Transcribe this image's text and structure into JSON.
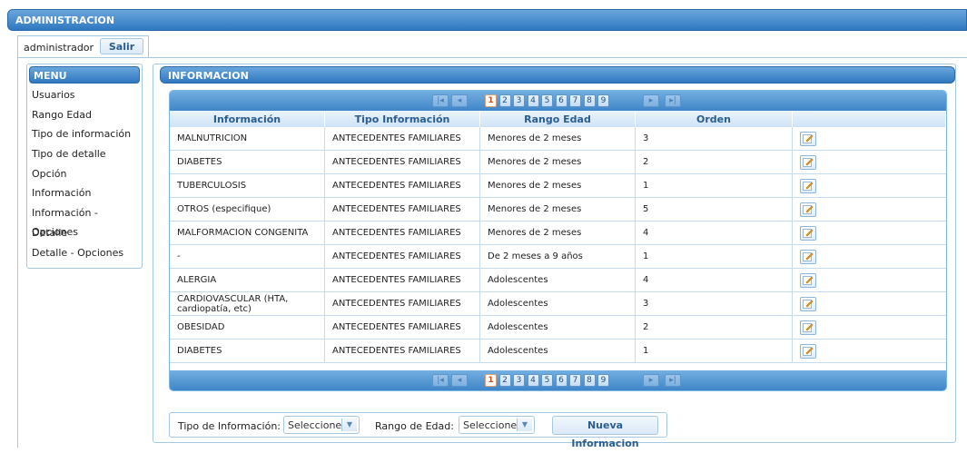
{
  "header": {
    "title": "ADMINISTRACION"
  },
  "user": {
    "name": "administrador",
    "logout_label": "Salir"
  },
  "menu": {
    "title": "MENU",
    "items": [
      {
        "label": "Usuarios"
      },
      {
        "label": "Rango Edad"
      },
      {
        "label": "Tipo de información"
      },
      {
        "label": "Tipo de detalle"
      },
      {
        "label": "Opción"
      },
      {
        "label": "Información"
      },
      {
        "label": "Información - Opciones"
      },
      {
        "label": "Detalle"
      },
      {
        "label": "Detalle - Opciones"
      }
    ]
  },
  "panel": {
    "title": "INFORMACION"
  },
  "pager": {
    "first_icon": "first-page-icon",
    "prev_icon": "prev-page-icon",
    "next_icon": "next-page-icon",
    "last_icon": "last-page-icon",
    "pages": [
      "1",
      "2",
      "3",
      "4",
      "5",
      "6",
      "7",
      "8",
      "9"
    ],
    "current_page": "1"
  },
  "table": {
    "headers": [
      "Información",
      "Tipo Información",
      "Rango Edad",
      "Orden",
      ""
    ],
    "rows": [
      {
        "informacion": "MALNUTRICION",
        "tipo": "ANTECEDENTES FAMILIARES",
        "rango": "Menores de 2 meses",
        "orden": "3"
      },
      {
        "informacion": "DIABETES",
        "tipo": "ANTECEDENTES FAMILIARES",
        "rango": "Menores de 2 meses",
        "orden": "2"
      },
      {
        "informacion": "TUBERCULOSIS",
        "tipo": "ANTECEDENTES FAMILIARES",
        "rango": "Menores de 2 meses",
        "orden": "1"
      },
      {
        "informacion": "OTROS (especifique)",
        "tipo": "ANTECEDENTES FAMILIARES",
        "rango": "Menores de 2 meses",
        "orden": "5"
      },
      {
        "informacion": "MALFORMACION CONGENITA",
        "tipo": "ANTECEDENTES FAMILIARES",
        "rango": "Menores de 2 meses",
        "orden": "4"
      },
      {
        "informacion": "-",
        "tipo": "ANTECEDENTES FAMILIARES",
        "rango": "De 2 meses a 9 años",
        "orden": "1"
      },
      {
        "informacion": "ALERGIA",
        "tipo": "ANTECEDENTES FAMILIARES",
        "rango": "Adolescentes",
        "orden": "4"
      },
      {
        "informacion": "CARDIOVASCULAR (HTA, cardiopatía, etc)",
        "tipo": "ANTECEDENTES FAMILIARES",
        "rango": "Adolescentes",
        "orden": "3"
      },
      {
        "informacion": "OBESIDAD",
        "tipo": "ANTECEDENTES FAMILIARES",
        "rango": "Adolescentes",
        "orden": "2"
      },
      {
        "informacion": "DIABETES",
        "tipo": "ANTECEDENTES FAMILIARES",
        "rango": "Adolescentes",
        "orden": "1"
      }
    ],
    "edit_icon": "edit-icon"
  },
  "filters": {
    "tipo_label": "Tipo de Información:",
    "tipo_value": "Seleccione...",
    "rango_label": "Rango de Edad:",
    "rango_value": "Seleccione...",
    "new_button": "Nueva Informacion"
  },
  "colors": {
    "accent": "#2f78c0",
    "border": "#a6c9e2",
    "header_text": "#2a5d8f"
  }
}
